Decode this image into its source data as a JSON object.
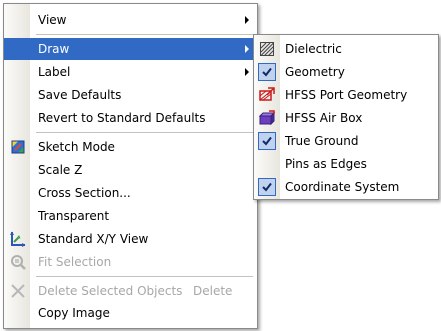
{
  "main_menu": {
    "items": [
      {
        "label": "View",
        "submenu": true
      },
      {
        "label": "Draw",
        "submenu": true,
        "selected": true
      },
      {
        "label": "Label",
        "submenu": true
      },
      {
        "label": "Save Defaults"
      },
      {
        "label": "Revert to Standard Defaults"
      },
      {
        "label": "Sketch Mode",
        "icon": "sketch-mode-icon"
      },
      {
        "label": "Scale Z"
      },
      {
        "label": "Cross Section..."
      },
      {
        "label": "Transparent"
      },
      {
        "label": "Standard X/Y View",
        "icon": "xy-axes-icon"
      },
      {
        "label": "Fit Selection",
        "icon": "zoom-fit-icon",
        "disabled": true
      },
      {
        "label": "Delete Selected Objects",
        "shortcut": "Delete",
        "icon": "delete-x-icon",
        "disabled": true
      },
      {
        "label": "Copy Image"
      }
    ]
  },
  "draw_submenu": {
    "items": [
      {
        "label": "Dielectric",
        "icon": "dielectric-hatch-icon"
      },
      {
        "label": "Geometry",
        "checked": true
      },
      {
        "label": "HFSS Port Geometry",
        "icon": "hfss-port-icon"
      },
      {
        "label": "HFSS Air Box",
        "icon": "hfss-airbox-icon"
      },
      {
        "label": "True Ground",
        "checked": true
      },
      {
        "label": "Pins as Edges"
      },
      {
        "label": "Coordinate System",
        "checked": true
      }
    ]
  },
  "colors": {
    "highlight": "#316ac5",
    "disabled_text": "#a7a7a7",
    "check_bg": "#c1d2ee",
    "separator": "#c5c2b8"
  }
}
